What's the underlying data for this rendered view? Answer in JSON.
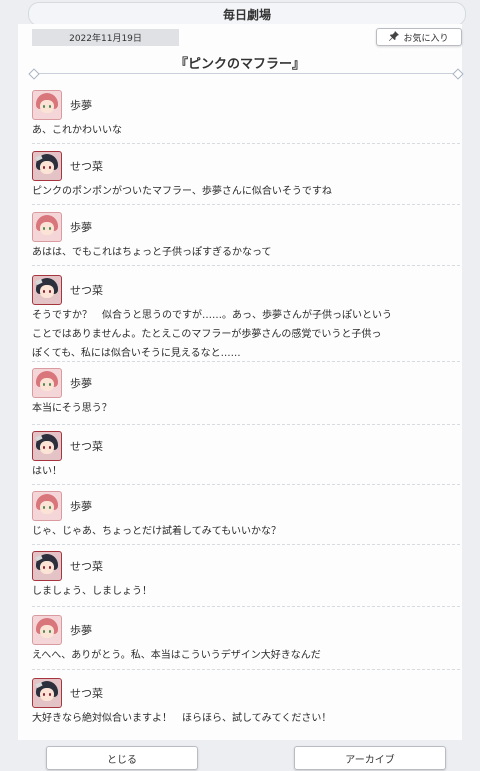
{
  "header": {
    "title": "毎日劇場"
  },
  "date": "2022年11月19日",
  "favorite_label": "お気に入り",
  "story_title": "『ピンクのマフラー』",
  "characters": {
    "ayumu": "歩夢",
    "setsuna": "せつ菜"
  },
  "dialogue": [
    {
      "speaker": "歩夢",
      "lines": [
        "あ、これかわいいな"
      ]
    },
    {
      "speaker": "せつ菜",
      "lines": [
        "ピンクのポンポンがついたマフラー、歩夢さんに似合いそうですね"
      ]
    },
    {
      "speaker": "歩夢",
      "lines": [
        "あはは、でもこれはちょっと子供っぽすぎるかなって"
      ]
    },
    {
      "speaker": "せつ菜",
      "lines": [
        "そうですか？　似合うと思うのですが……。あっ、歩夢さんが子供っぽいという",
        "ことではありませんよ。たとえこのマフラーが歩夢さんの感覚でいうと子供っ",
        "ぽくても、私には似合いそうに見えるなと……"
      ]
    },
    {
      "speaker": "歩夢",
      "lines": [
        "本当にそう思う？"
      ]
    },
    {
      "speaker": "せつ菜",
      "lines": [
        "はい！"
      ]
    },
    {
      "speaker": "歩夢",
      "lines": [
        "じゃ、じゃあ、ちょっとだけ試着してみてもいいかな？"
      ]
    },
    {
      "speaker": "せつ菜",
      "lines": [
        "しましょう、しましょう！"
      ]
    },
    {
      "speaker": "歩夢",
      "lines": [
        "えへへ、ありがとう。私、本当はこういうデザイン大好きなんだ"
      ]
    },
    {
      "speaker": "せつ菜",
      "lines": [
        "大好きなら絶対似合いますよ！　ほらほら、試してみてください！"
      ]
    }
  ],
  "buttons": {
    "close": "とじる",
    "archive": "アーカイブ"
  },
  "icons": {
    "favorite": "pin-icon"
  }
}
